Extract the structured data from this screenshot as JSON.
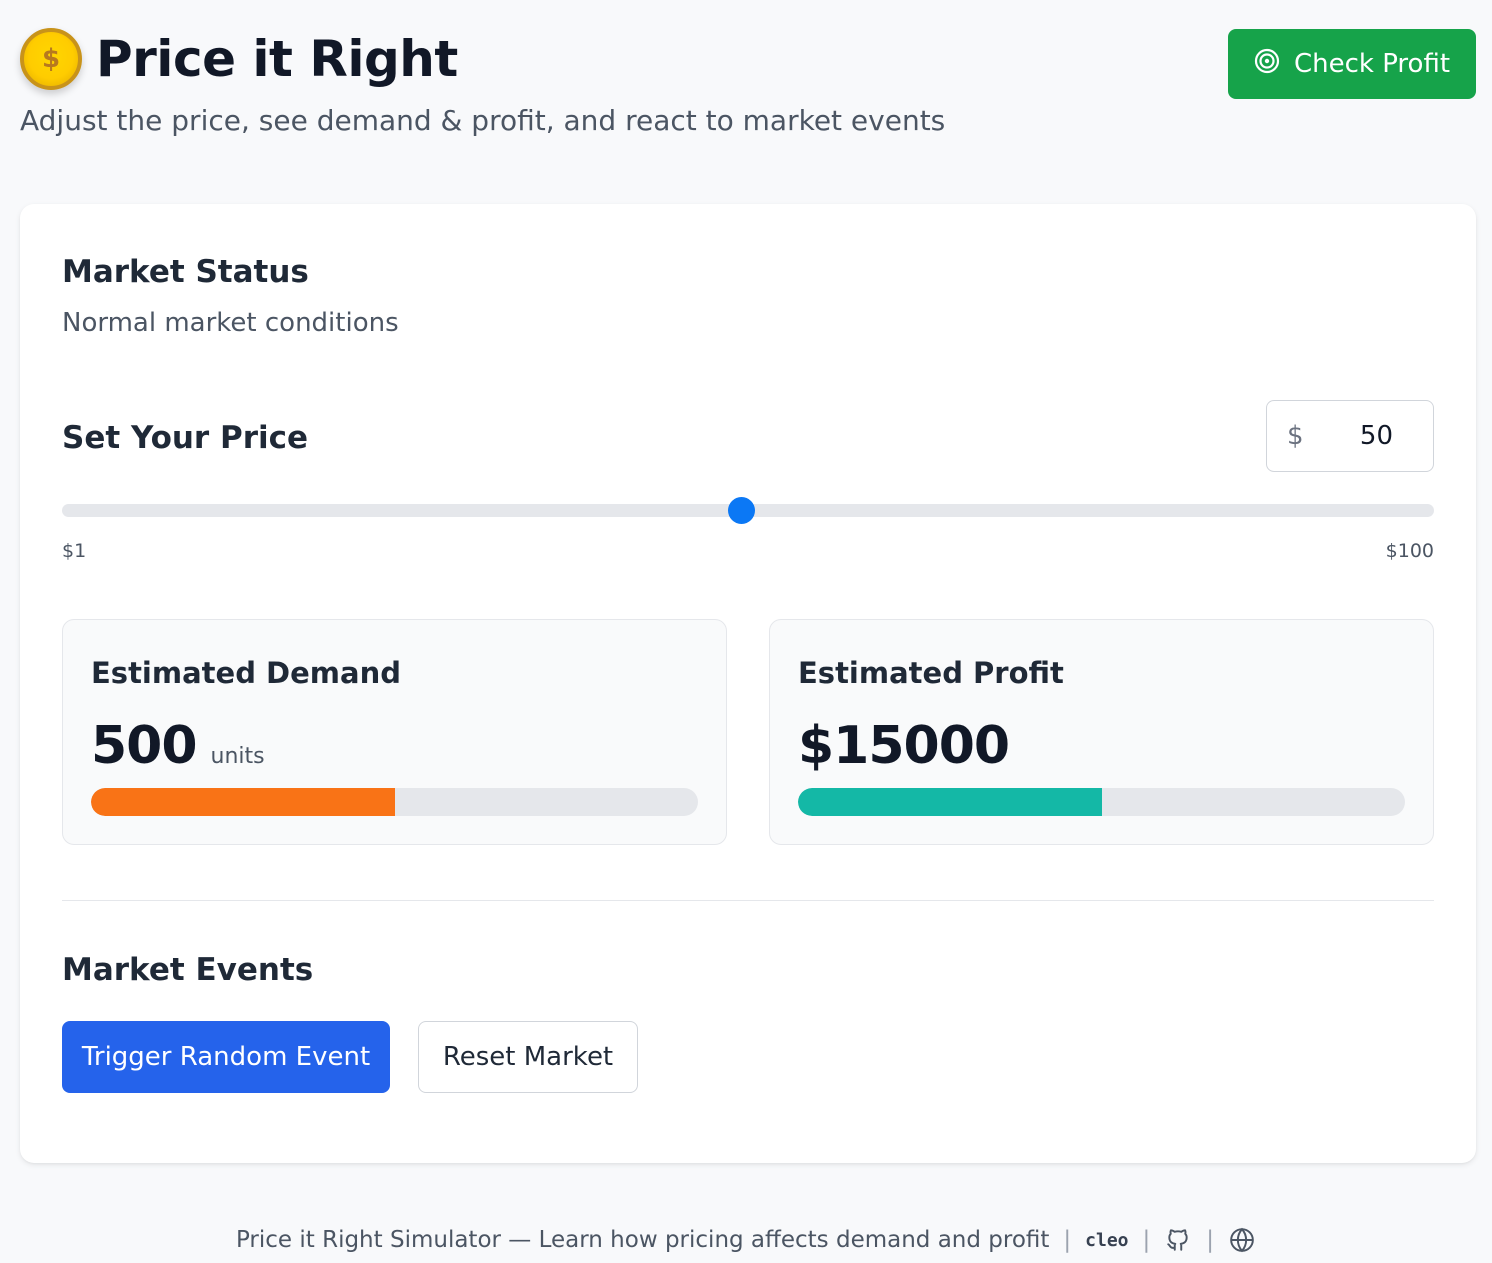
{
  "header": {
    "coin_symbol": "$",
    "title": "Price it Right",
    "subtitle": "Adjust the price, see demand & profit, and react to market events",
    "check_profit_label": "Check Profit"
  },
  "market_status": {
    "heading": "Market Status",
    "text": "Normal market conditions"
  },
  "price": {
    "heading": "Set Your Price",
    "currency_symbol": "$",
    "value": "50",
    "min_label": "$1",
    "max_label": "$100",
    "min": 1,
    "max": 100
  },
  "demand": {
    "title": "Estimated Demand",
    "value": "500",
    "unit": "units",
    "fill_fraction": 0.5
  },
  "profit": {
    "title": "Estimated Profit",
    "value": "$15000",
    "fill_fraction": 0.5
  },
  "events": {
    "heading": "Market Events",
    "trigger_label": "Trigger Random Event",
    "reset_label": "Reset Market"
  },
  "footer": {
    "text": "Price it Right Simulator — Learn how pricing affects demand and profit",
    "brand": "cleo"
  },
  "colors": {
    "check_button": "#16a34a",
    "primary_button": "#2563eb",
    "slider_thumb": "#0b78f5",
    "demand_bar": "#f97316",
    "profit_bar": "#14b8a6"
  },
  "icons": {
    "check_button": "target-icon",
    "footer_github": "github-icon",
    "footer_web": "globe-icon"
  }
}
